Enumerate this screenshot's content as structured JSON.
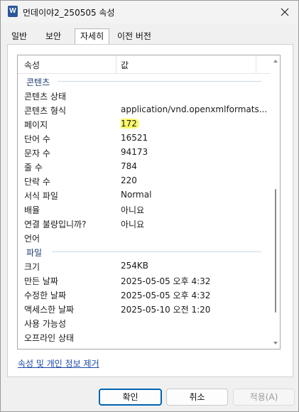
{
  "window": {
    "title": "먼데이야2_250505 속성",
    "app_icon_letter": "W"
  },
  "tabs": [
    {
      "label": "일반"
    },
    {
      "label": "보안"
    },
    {
      "label": "자세히",
      "active": true
    },
    {
      "label": "이전 버전"
    }
  ],
  "details": {
    "columns": {
      "property": "속성",
      "value": "값"
    },
    "groups": [
      {
        "label": "콘텐츠",
        "rows": [
          {
            "name": "콘텐츠 상태",
            "value": ""
          },
          {
            "name": "콘텐츠 형식",
            "value": "application/vnd.openxmlformats..."
          },
          {
            "name": "페이지",
            "value": "172",
            "highlight": true
          },
          {
            "name": "단어 수",
            "value": "16521"
          },
          {
            "name": "문자 수",
            "value": "94173"
          },
          {
            "name": "줄 수",
            "value": "784"
          },
          {
            "name": "단락 수",
            "value": "220"
          },
          {
            "name": "서식 파일",
            "value": "Normal"
          },
          {
            "name": "배율",
            "value": "아니요"
          },
          {
            "name": "연결 불량입니까?",
            "value": "아니요"
          },
          {
            "name": "언어",
            "value": ""
          }
        ]
      },
      {
        "label": "파일",
        "rows": [
          {
            "name": "크기",
            "value": "254KB"
          },
          {
            "name": "만든 날짜",
            "value": "2025-05-05 오후 4:32"
          },
          {
            "name": "수정한 날짜",
            "value": "2025-05-05 오후 4:32"
          },
          {
            "name": "액세스한 날짜",
            "value": "2025-05-10 오전 1:20"
          },
          {
            "name": "사용 가능성",
            "value": ""
          },
          {
            "name": "오프라인 상태",
            "value": ""
          }
        ]
      }
    ]
  },
  "remove_link": "속성 및 개인 정보 제거",
  "buttons": {
    "ok": "확인",
    "cancel": "취소",
    "apply": "적용(A)"
  },
  "colors": {
    "highlight": "#fbfa6a",
    "group_label": "#1c3a6e",
    "link": "#1a4aa8",
    "primary_border": "#0063b1"
  },
  "icons": {
    "app": "word-document-icon",
    "close": "close-icon"
  }
}
